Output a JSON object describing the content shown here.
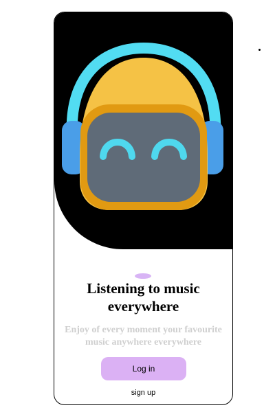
{
  "onboarding": {
    "title": "Listening to music everywhere",
    "subtitle": "Enjoy of every moment your favourite music anywhere everywhere",
    "login_label": "Log in",
    "signup_label": "sign up",
    "illustration": "robot-with-headphones-icon"
  },
  "colors": {
    "hero_background": "#000000",
    "page_indicator": "#d8b4f5",
    "login_button": "#dbb1f4",
    "subtitle_text": "#cfcfcf",
    "headphone_band": "#52dcf2",
    "helmet": "#f5c245",
    "visor": "#5f6b78",
    "eyes": "#4fd8ee",
    "earcups": "#4a9ee8"
  }
}
